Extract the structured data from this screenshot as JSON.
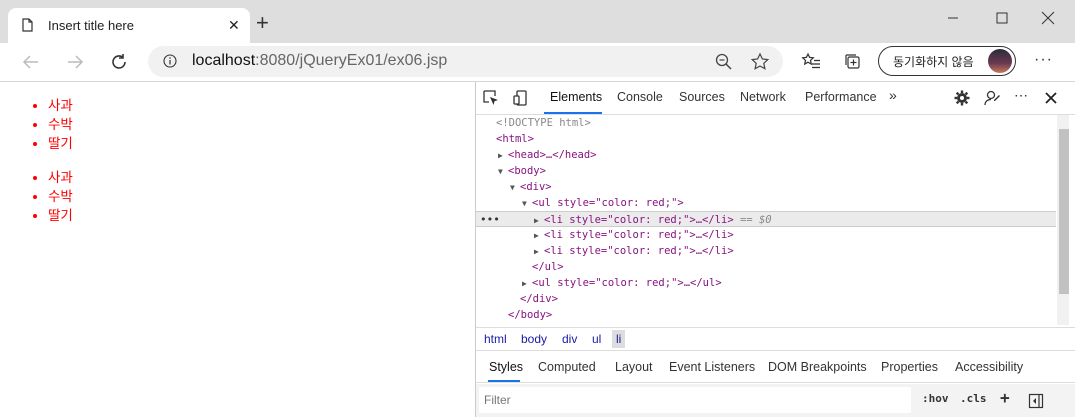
{
  "browser": {
    "tab_title": "Insert title here",
    "url_host": "localhost",
    "url_path": ":8080/jQueryEx01/ex06.jsp",
    "sync_label": "동기화하지 않음"
  },
  "page": {
    "list1": [
      "사과",
      "수박",
      "딸기"
    ],
    "list2": [
      "사과",
      "수박",
      "딸기"
    ],
    "text_color": "#ff0000"
  },
  "devtools": {
    "tabs": [
      "Elements",
      "Console",
      "Sources",
      "Network",
      "Performance"
    ],
    "dom_lines": {
      "doctype": "<!DOCTYPE html>",
      "html_open": "<html>",
      "head": "<head>…</head>",
      "body_open": "<body>",
      "div_open": "<div>",
      "ul_open": "<ul style=\"color: red;\">",
      "li_1": "<li style=\"color: red;\">…</li>",
      "li_selected_marker": "== $0",
      "li_2": "<li style=\"color: red;\">…</li>",
      "li_3": "<li style=\"color: red;\">…</li>",
      "ul_close": "</ul>",
      "ul_2": "<ul style=\"color: red;\">…</ul>",
      "div_close": "</div>",
      "body_close": "</body>"
    },
    "breadcrumbs": [
      "html",
      "body",
      "div",
      "ul",
      "li"
    ],
    "subtabs": [
      "Styles",
      "Computed",
      "Layout",
      "Event Listeners",
      "DOM Breakpoints",
      "Properties",
      "Accessibility"
    ],
    "filter_placeholder": "Filter",
    "hov_label": ":hov",
    "cls_label": ".cls"
  }
}
